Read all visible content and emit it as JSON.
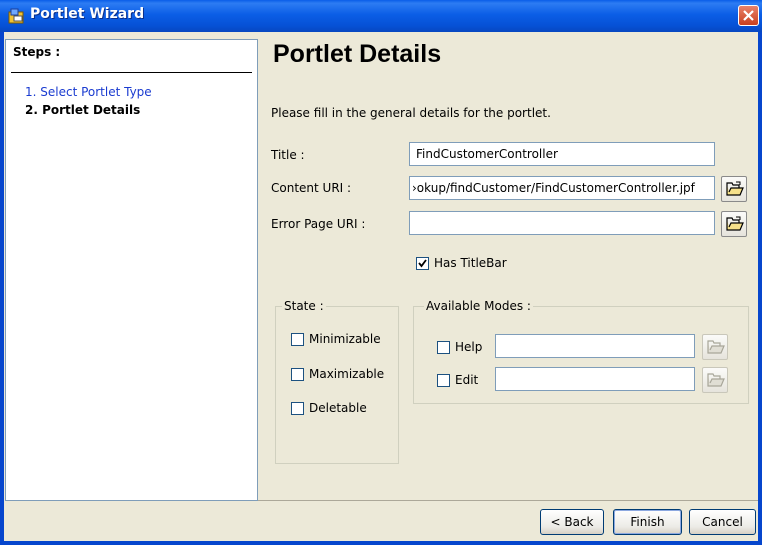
{
  "window": {
    "title": "Portlet Wizard"
  },
  "steps": {
    "heading": "Steps :",
    "items": [
      {
        "label": "1. Select Portlet Type",
        "state": "link"
      },
      {
        "label": "2. Portlet Details",
        "state": "current"
      }
    ]
  },
  "main": {
    "title": "Portlet Details",
    "description": "Please fill in the general details for the portlet.",
    "fields": {
      "title": {
        "label": "Title :",
        "value": "FindCustomerController"
      },
      "content_uri": {
        "label": "Content URI :",
        "value": "›okup/findCustomer/FindCustomerController.jpf"
      },
      "error_uri": {
        "label": "Error Page URI :",
        "value": ""
      }
    },
    "has_titlebar": {
      "label": "Has TitleBar",
      "checked": true
    },
    "state_group": {
      "title": "State :",
      "options": [
        {
          "label": "Minimizable",
          "checked": false
        },
        {
          "label": "Maximizable",
          "checked": false
        },
        {
          "label": "Deletable",
          "checked": false
        }
      ]
    },
    "modes_group": {
      "title": "Available Modes :",
      "options": [
        {
          "label": "Help",
          "checked": false,
          "value": ""
        },
        {
          "label": "Edit",
          "checked": false,
          "value": ""
        }
      ]
    }
  },
  "buttons": {
    "back": "< Back",
    "finish": "Finish",
    "cancel": "Cancel"
  },
  "colors": {
    "titlebar": "#0a5de8",
    "step_link": "#1a3bd0",
    "dialog_bg": "#ece9d8"
  },
  "icons": {
    "title": "wizard-icon",
    "close": "close-icon",
    "browse": "open-folder-icon"
  }
}
